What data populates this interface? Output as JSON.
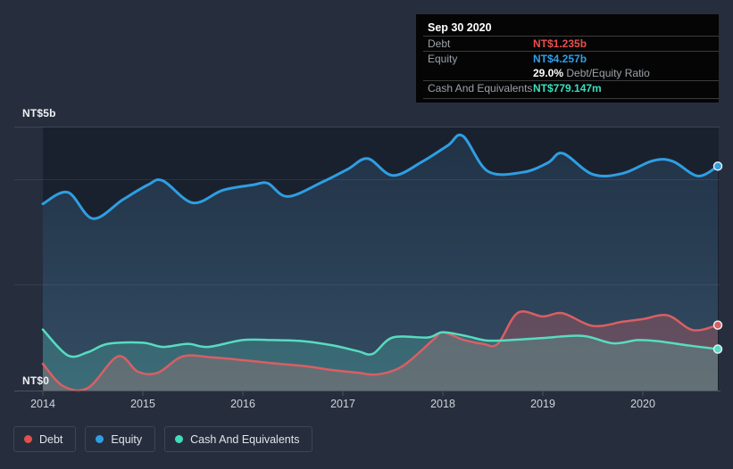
{
  "y_axis_top_label": "NT$5b",
  "y_axis_bottom_label": "NT$0",
  "tooltip": {
    "date": "Sep 30 2020",
    "debt_label": "Debt",
    "debt_value": "NT$1.235b",
    "equity_label": "Equity",
    "equity_value": "NT$4.257b",
    "ratio_value": "29.0%",
    "ratio_label": " Debt/Equity Ratio",
    "cash_label": "Cash And Equivalents",
    "cash_value": "NT$779.147m"
  },
  "legend": {
    "items": [
      {
        "label": "Debt",
        "color": "#e0504e"
      },
      {
        "label": "Equity",
        "color": "#2f9ee3"
      },
      {
        "label": "Cash And Equivalents",
        "color": "#43dcb9"
      }
    ]
  },
  "chart_data": {
    "type": "area",
    "title": "Debt to Equity History",
    "y_unit": "NT$ billions",
    "ylim": [
      0,
      5
    ],
    "xlim": [
      2014.0,
      2020.75
    ],
    "x_ticks": [
      "2014",
      "2015",
      "2016",
      "2017",
      "2018",
      "2019",
      "2020"
    ],
    "x_tick_years": [
      2014,
      2015,
      2016,
      2017,
      2018,
      2019,
      2020
    ],
    "gridlines_strong": [
      5
    ],
    "gridlines_faint": [
      4,
      2
    ],
    "grid": true,
    "legend_position": "bottom-left",
    "series": [
      {
        "name": "Debt",
        "color": "#d95f63",
        "fill": "rgba(217,95,99,0.30)",
        "points": [
          [
            2014.0,
            0.5
          ],
          [
            2014.2,
            0.08
          ],
          [
            2014.45,
            0.04
          ],
          [
            2014.75,
            0.64
          ],
          [
            2014.95,
            0.35
          ],
          [
            2015.15,
            0.33
          ],
          [
            2015.4,
            0.64
          ],
          [
            2015.7,
            0.62
          ],
          [
            2016.0,
            0.57
          ],
          [
            2016.3,
            0.51
          ],
          [
            2016.6,
            0.46
          ],
          [
            2016.9,
            0.38
          ],
          [
            2017.15,
            0.33
          ],
          [
            2017.35,
            0.3
          ],
          [
            2017.6,
            0.46
          ],
          [
            2017.9,
            0.95
          ],
          [
            2018.0,
            1.1
          ],
          [
            2018.2,
            0.96
          ],
          [
            2018.4,
            0.88
          ],
          [
            2018.55,
            0.88
          ],
          [
            2018.75,
            1.47
          ],
          [
            2019.0,
            1.4
          ],
          [
            2019.2,
            1.46
          ],
          [
            2019.5,
            1.22
          ],
          [
            2019.8,
            1.3
          ],
          [
            2020.0,
            1.35
          ],
          [
            2020.25,
            1.42
          ],
          [
            2020.5,
            1.14
          ],
          [
            2020.75,
            1.235
          ]
        ]
      },
      {
        "name": "Equity",
        "color": "#2f9ee3",
        "fill_top": "rgba(77,150,210,0.15)",
        "fill_bottom": "rgba(110,172,212,0.32)",
        "points": [
          [
            2014.0,
            3.54
          ],
          [
            2014.25,
            3.76
          ],
          [
            2014.5,
            3.26
          ],
          [
            2014.8,
            3.62
          ],
          [
            2015.05,
            3.9
          ],
          [
            2015.2,
            3.98
          ],
          [
            2015.5,
            3.56
          ],
          [
            2015.8,
            3.8
          ],
          [
            2016.1,
            3.9
          ],
          [
            2016.25,
            3.93
          ],
          [
            2016.45,
            3.68
          ],
          [
            2016.8,
            3.96
          ],
          [
            2017.05,
            4.2
          ],
          [
            2017.25,
            4.4
          ],
          [
            2017.5,
            4.08
          ],
          [
            2017.8,
            4.35
          ],
          [
            2018.05,
            4.65
          ],
          [
            2018.2,
            4.83
          ],
          [
            2018.45,
            4.16
          ],
          [
            2018.8,
            4.14
          ],
          [
            2019.05,
            4.32
          ],
          [
            2019.2,
            4.5
          ],
          [
            2019.5,
            4.1
          ],
          [
            2019.8,
            4.12
          ],
          [
            2020.1,
            4.36
          ],
          [
            2020.3,
            4.35
          ],
          [
            2020.55,
            4.07
          ],
          [
            2020.75,
            4.257
          ]
        ]
      },
      {
        "name": "Cash And Equivalents",
        "color": "#57dcc1",
        "fill": "rgba(87,220,193,0.22)",
        "points": [
          [
            2014.0,
            1.15
          ],
          [
            2014.25,
            0.66
          ],
          [
            2014.45,
            0.72
          ],
          [
            2014.65,
            0.88
          ],
          [
            2015.0,
            0.9
          ],
          [
            2015.2,
            0.82
          ],
          [
            2015.45,
            0.88
          ],
          [
            2015.65,
            0.82
          ],
          [
            2016.0,
            0.95
          ],
          [
            2016.3,
            0.95
          ],
          [
            2016.6,
            0.93
          ],
          [
            2016.9,
            0.85
          ],
          [
            2017.15,
            0.74
          ],
          [
            2017.3,
            0.69
          ],
          [
            2017.5,
            1.0
          ],
          [
            2017.85,
            1.0
          ],
          [
            2018.0,
            1.1
          ],
          [
            2018.25,
            1.02
          ],
          [
            2018.45,
            0.94
          ],
          [
            2018.75,
            0.96
          ],
          [
            2019.0,
            0.99
          ],
          [
            2019.4,
            1.03
          ],
          [
            2019.7,
            0.89
          ],
          [
            2019.95,
            0.95
          ],
          [
            2020.15,
            0.93
          ],
          [
            2020.45,
            0.85
          ],
          [
            2020.75,
            0.779
          ]
        ]
      }
    ]
  }
}
